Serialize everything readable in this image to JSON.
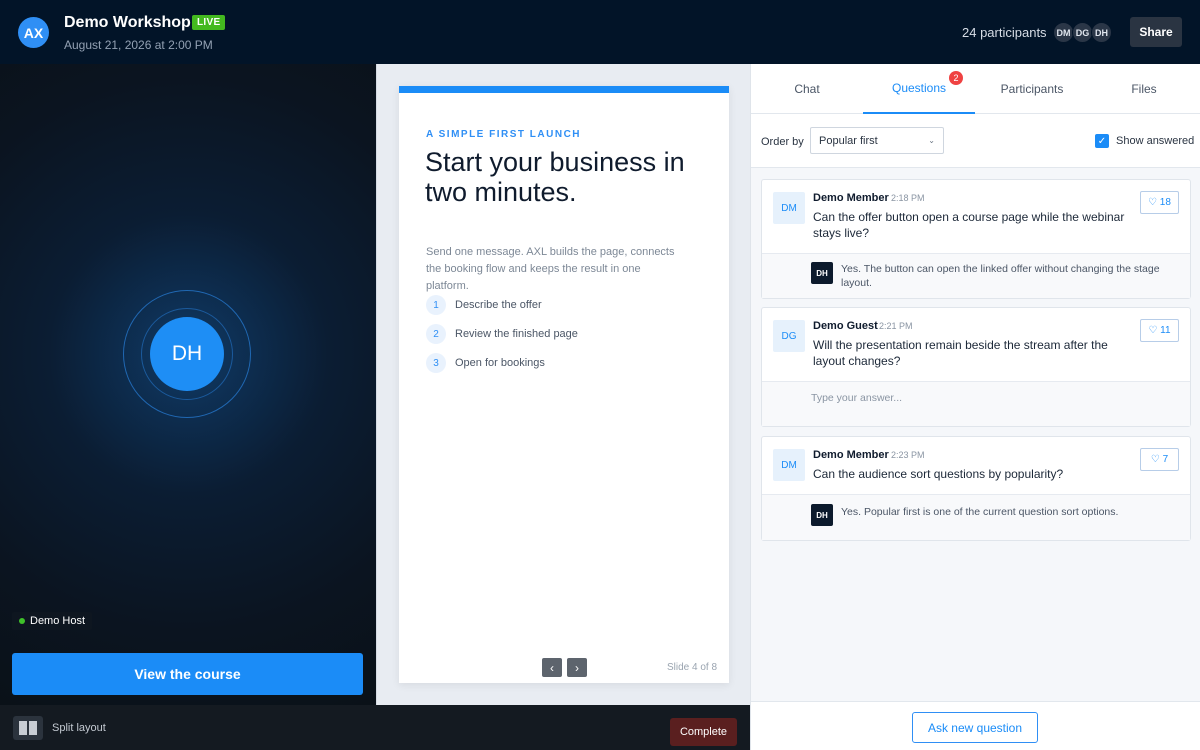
{
  "header": {
    "logo": "AX",
    "title": "Demo Workshop",
    "live_badge": "LIVE",
    "date": "August 21, 2026 at 2:00 PM",
    "participants_count": "24 participants",
    "avatars": [
      "DM",
      "DG",
      "DH"
    ],
    "share_label": "Share"
  },
  "stage": {
    "host_initials": "DH",
    "host_name": "Demo Host",
    "cta_label": "View the course"
  },
  "bottombar": {
    "split_label": "Split layout",
    "complete_label": "Complete"
  },
  "slide": {
    "kicker": "A SIMPLE FIRST LAUNCH",
    "headline": "Start your business in two minutes.",
    "lead": "Send one message. AXL builds the page, connects the booking flow and keeps the result in one platform.",
    "steps": [
      {
        "num": "1",
        "text": "Describe the offer"
      },
      {
        "num": "2",
        "text": "Review the finished page"
      },
      {
        "num": "3",
        "text": "Open for bookings"
      }
    ],
    "prev": "‹",
    "next": "›",
    "counter": "Slide 4 of 8"
  },
  "panel": {
    "tabs": [
      "Chat",
      "Questions",
      "Participants",
      "Files"
    ],
    "questions_badge": "2",
    "order_label": "Order by",
    "order_value": "Popular first",
    "show_answered_label": "Show answered",
    "questions": [
      {
        "avatar": "DM",
        "author": "Demo Member",
        "time": "2:18 PM",
        "text": "Can the offer button open a course page while the webinar stays live?",
        "likes": "♡ 18",
        "answer_avatar": "DH",
        "answer": "Yes. The button can open the linked offer without changing the stage layout."
      },
      {
        "avatar": "DG",
        "author": "Demo Guest",
        "time": "2:21 PM",
        "text": "Will the presentation remain beside the stream after the layout changes?",
        "likes": "♡ 11",
        "answer_placeholder": "Type your answer..."
      },
      {
        "avatar": "DM",
        "author": "Demo Member",
        "time": "2:23 PM",
        "text": "Can the audience sort questions by popularity?",
        "likes": "♡ 7",
        "answer_avatar": "DH",
        "answer": "Yes. Popular first is one of the current question sort options."
      }
    ],
    "ask_label": "Ask new question"
  },
  "colors": {
    "accent": "#1b8cf7",
    "header_bg": "#021428",
    "live": "#43b91f",
    "complete": "#5a1f1f",
    "badge": "#ef4242"
  }
}
